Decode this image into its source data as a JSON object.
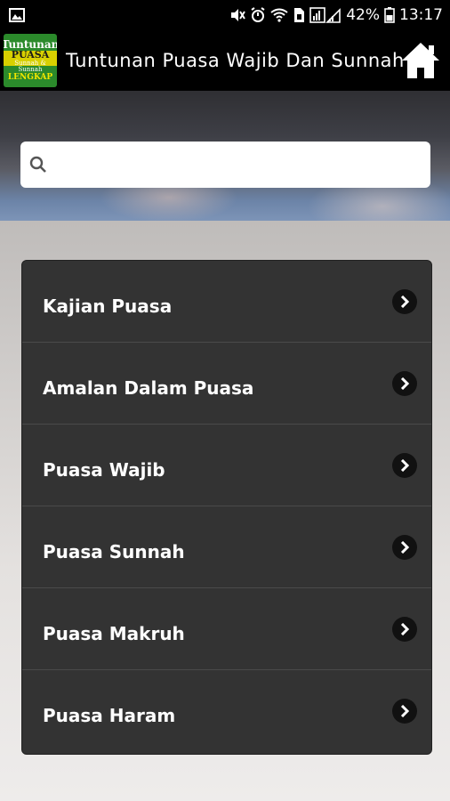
{
  "status_bar": {
    "battery_percent": "42%",
    "time": "13:17"
  },
  "app_bar": {
    "title": "Tuntunan Puasa Wajib Dan Sunnah",
    "logo": {
      "line1": "Tuntunan",
      "line2": "PUASA",
      "line3": "Sunnah & Sunnah",
      "line4": "LENGKAP"
    },
    "home_icon": "home-icon"
  },
  "search": {
    "placeholder": "",
    "value": "",
    "icon": "search-icon"
  },
  "menu": {
    "items": [
      {
        "label": "Kajian Puasa"
      },
      {
        "label": "Amalan Dalam Puasa"
      },
      {
        "label": "Puasa Wajib"
      },
      {
        "label": "Puasa Sunnah"
      },
      {
        "label": "Puasa Makruh"
      },
      {
        "label": "Puasa Haram"
      }
    ],
    "chevron_icon": "chevron-right-icon"
  },
  "colors": {
    "bar_bg": "#000000",
    "menu_bg": "#333333",
    "divider": "#4a4a4a",
    "text": "#ffffff"
  }
}
